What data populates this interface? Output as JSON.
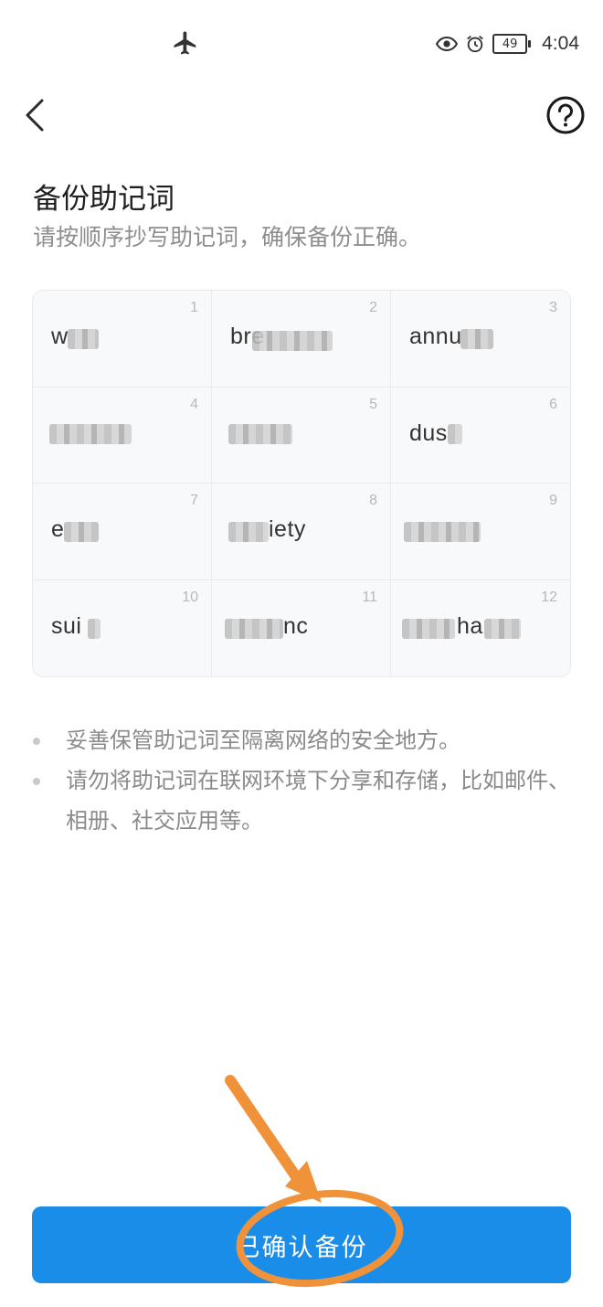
{
  "status_bar": {
    "battery_level": "49",
    "time": "4:04",
    "icons": [
      "airplane-mode-icon",
      "eye-icon",
      "alarm-icon",
      "battery-icon"
    ]
  },
  "header": {
    "back_icon": "chevron-left-icon",
    "help_icon": "question-circle-icon"
  },
  "page": {
    "title": "备份助记词",
    "subtitle": "请按顺序抄写助记词，确保备份正确。"
  },
  "mnemonic": {
    "words": [
      {
        "index": "1",
        "visible_text": "w"
      },
      {
        "index": "2",
        "visible_text": "bre"
      },
      {
        "index": "3",
        "visible_text": "annu"
      },
      {
        "index": "4",
        "visible_text": ""
      },
      {
        "index": "5",
        "visible_text": ""
      },
      {
        "index": "6",
        "visible_text": "dus"
      },
      {
        "index": "7",
        "visible_text": "e"
      },
      {
        "index": "8",
        "visible_text": "iety"
      },
      {
        "index": "9",
        "visible_text": ""
      },
      {
        "index": "10",
        "visible_text": "sui"
      },
      {
        "index": "11",
        "visible_text": "nc"
      },
      {
        "index": "12",
        "visible_text": "ha"
      }
    ]
  },
  "tips": [
    "妥善保管助记词至隔离网络的安全地方。",
    "请勿将助记词在联网环境下分享和存储，比如邮件、相册、社交应用等。"
  ],
  "confirm_button": {
    "label": "已确认备份"
  },
  "colors": {
    "primary": "#1a8de8",
    "annotation": "#f0923a"
  }
}
